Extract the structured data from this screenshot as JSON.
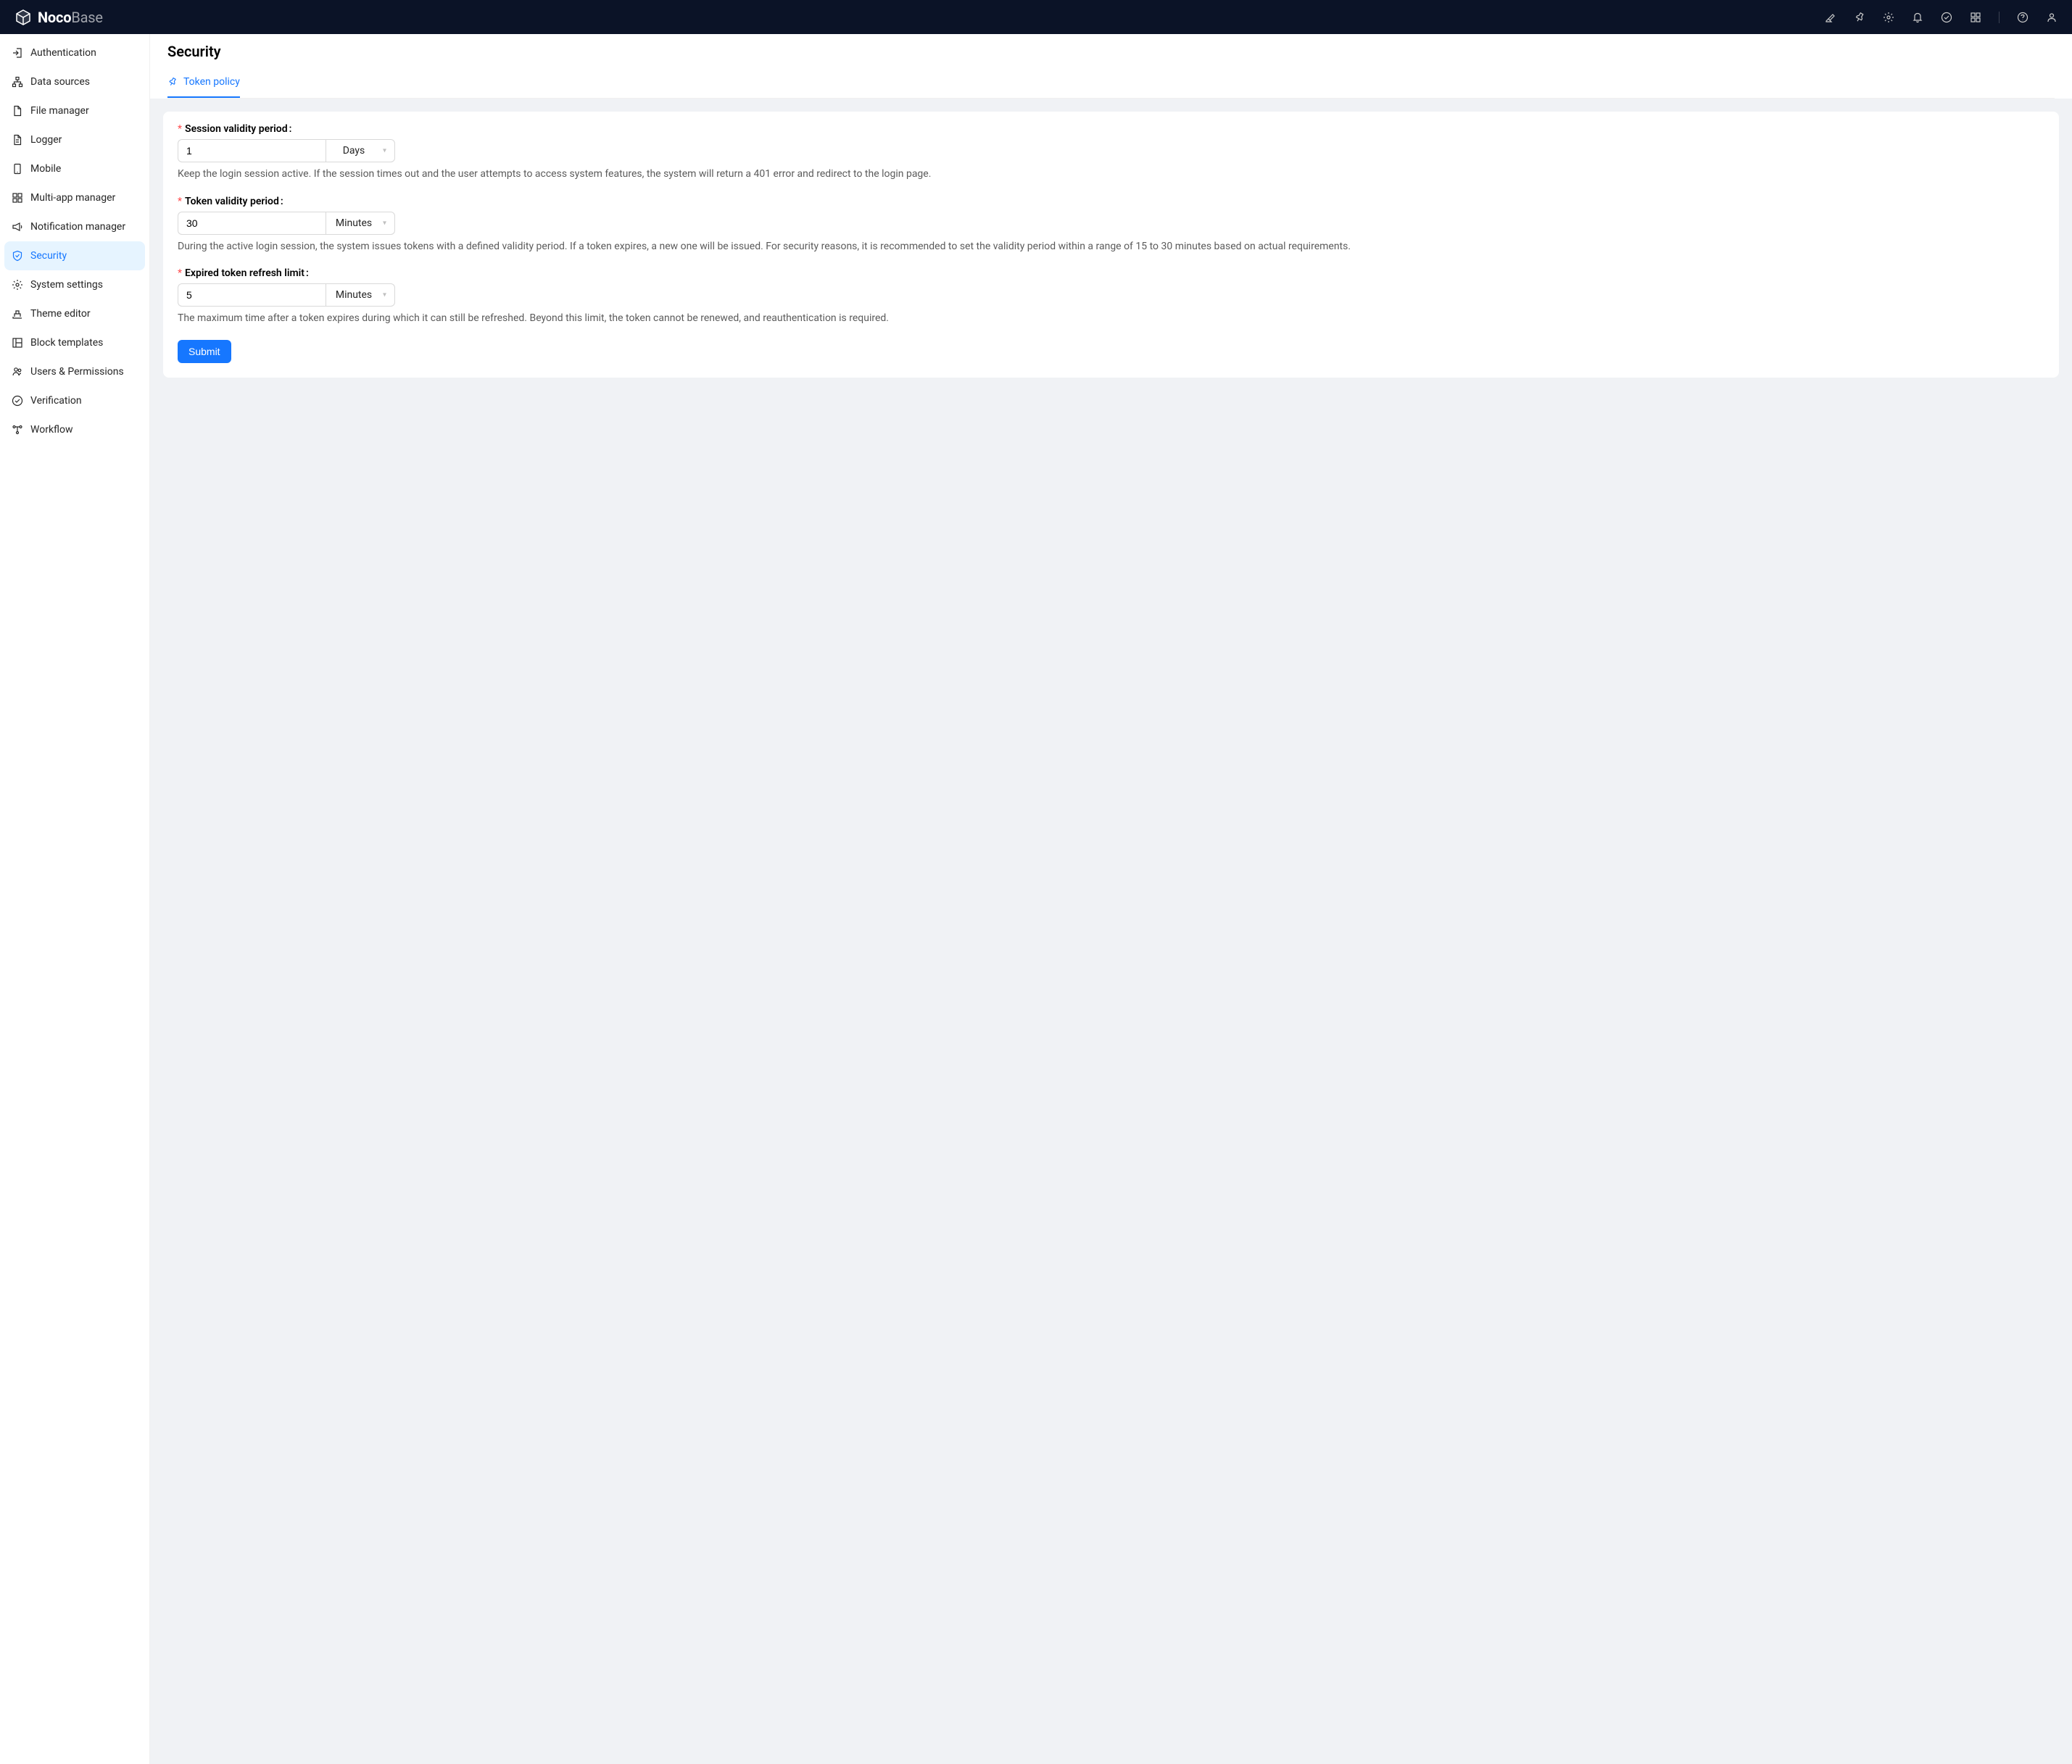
{
  "brand": {
    "name_prefix": "Noco",
    "name_suffix": "Base"
  },
  "sidebar": {
    "items": [
      {
        "label": "Authentication"
      },
      {
        "label": "Data sources"
      },
      {
        "label": "File manager"
      },
      {
        "label": "Logger"
      },
      {
        "label": "Mobile"
      },
      {
        "label": "Multi-app manager"
      },
      {
        "label": "Notification manager"
      },
      {
        "label": "Security"
      },
      {
        "label": "System settings"
      },
      {
        "label": "Theme editor"
      },
      {
        "label": "Block templates"
      },
      {
        "label": "Users & Permissions"
      },
      {
        "label": "Verification"
      },
      {
        "label": "Workflow"
      }
    ]
  },
  "page": {
    "title": "Security",
    "tab_label": "Token policy"
  },
  "form": {
    "session": {
      "label": "Session validity period",
      "value": "1",
      "unit": "Days",
      "help": "Keep the login session active. If the session times out and the user attempts to access system features, the system will return a 401 error and redirect to the login page."
    },
    "token": {
      "label": "Token validity period",
      "value": "30",
      "unit": "Minutes",
      "help": "During the active login session, the system issues tokens with a defined validity period. If a token expires, a new one will be issued. For security reasons, it is recommended to set the validity period within a range of 15 to 30 minutes based on actual requirements."
    },
    "refresh": {
      "label": "Expired token refresh limit",
      "value": "5",
      "unit": "Minutes",
      "help": "The maximum time after a token expires during which it can still be refreshed. Beyond this limit, the token cannot be renewed, and reauthentication is required."
    },
    "submit_label": "Submit"
  }
}
